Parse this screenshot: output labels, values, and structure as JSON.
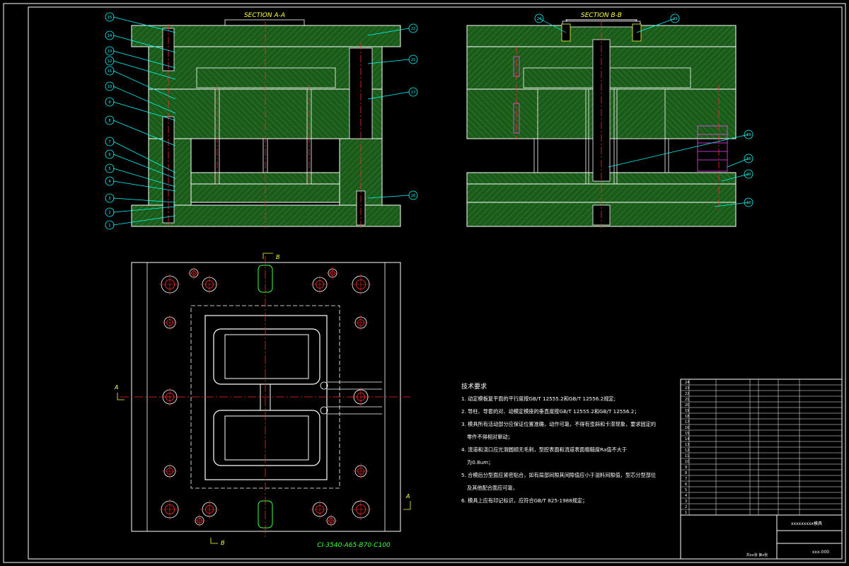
{
  "views": {
    "section_a": "SECTION A-A",
    "section_b": "SECTION B-B",
    "plan_code": "CI-3540-A65-B70-C100"
  },
  "section_letters": {
    "a": "A",
    "b": "B"
  },
  "callouts_a_left": [
    "15",
    "14",
    "13",
    "12",
    "11",
    "10",
    "9",
    "8",
    "7",
    "6",
    "5",
    "4",
    "3",
    "2",
    "1"
  ],
  "callouts_a_right": [
    "22",
    "21",
    "17",
    "16"
  ],
  "callouts_b": [
    "24",
    "23",
    "19",
    "18",
    "20",
    "18"
  ],
  "notes": {
    "heading": "技术要求",
    "items": [
      "1. 动定模板复平面的平行度按GB/T 12555.2和GB/T 12556.2规定;",
      "2. 导柱、导套的对、动模定模座的垂直度按GB/T 12555.2和GB/T 12556.2；",
      "3. 模具所有活动部分应保证位置准确，动作可靠，不得有歪斜和卡滞现象，要求固定的",
      "零件不得相对窜动；",
      "4. 流道和浇口应光滑圆顺无毛刺，型腔表面和流道表面粗糙度Ra值不大于",
      "为0.8um；",
      "5. 合模后分型面应紧密贴合，如有局部间隙其间隙值应小于溢料间隙值，型芯分型部位",
      "及其他配合面应可靠，",
      "6. 模具上应有印记标识，应符合GB/T 825-1988规定；"
    ]
  },
  "title_block": {
    "drawing_title": "xxxxxxxxx模具",
    "drawing_no": "xxx-000",
    "scale_note": "共xx张 第x张",
    "part_rows": [
      "24",
      "23",
      "22",
      "21",
      "20",
      "19",
      "18",
      "17",
      "16",
      "15",
      "14",
      "13",
      "12",
      "11",
      "10",
      "9",
      "8",
      "7",
      "6",
      "5",
      "4",
      "3",
      "2",
      "1"
    ]
  },
  "colors": {
    "background": "#000000",
    "hatch": "#1f6b1f",
    "outline": "#ffffff",
    "centerline": "#ff2a2a",
    "callout": "#00ffff",
    "yellow": "#ffff40",
    "frame": "#ffffff"
  }
}
